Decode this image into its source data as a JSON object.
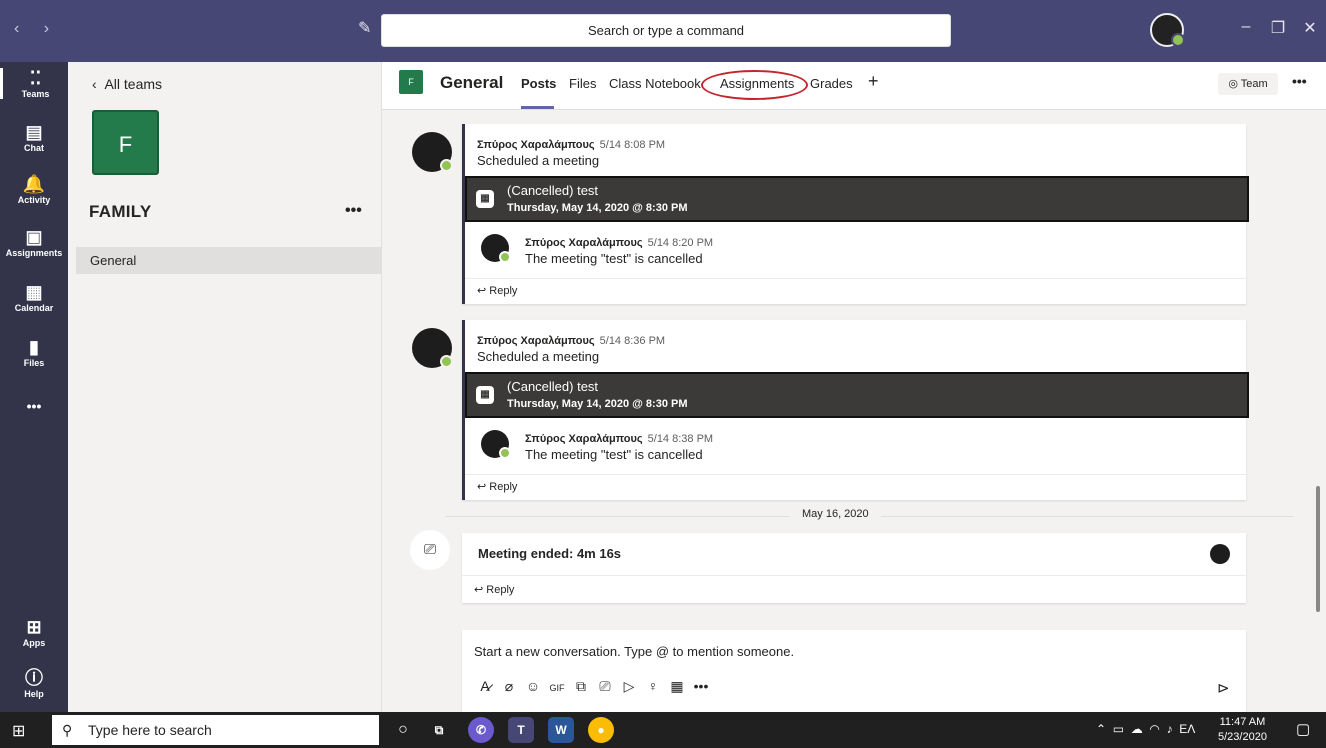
{
  "search": {
    "placeholder": "Search or type a command"
  },
  "rail": {
    "items": [
      {
        "label": "Teams",
        "icon": "teams-icon",
        "glyph": "⁚⁚"
      },
      {
        "label": "Chat",
        "icon": "chat-icon",
        "glyph": "▤"
      },
      {
        "label": "Activity",
        "icon": "bell-icon",
        "glyph": "🔔"
      },
      {
        "label": "Assignments",
        "icon": "assignments-icon",
        "glyph": "▣"
      },
      {
        "label": "Calendar",
        "icon": "calendar-icon",
        "glyph": "▦"
      },
      {
        "label": "Files",
        "icon": "files-icon",
        "glyph": "▮"
      }
    ],
    "more": "•••",
    "apps_label": "Apps",
    "help_label": "Help"
  },
  "team_panel": {
    "back_label": "All teams",
    "team_initial": "F",
    "team_name": "FAMILY",
    "more": "•••",
    "channel": "General"
  },
  "header": {
    "channel_initial": "F",
    "channel_name": "General",
    "tabs": [
      "Posts",
      "Files",
      "Class Notebook",
      "Assignments",
      "Grades"
    ],
    "add": "+",
    "team_button": "◎ Team",
    "more": "•••"
  },
  "posts": [
    {
      "author": "Σπύρος Χαραλάμπους",
      "time": "5/14 8:08 PM",
      "text": "Scheduled a meeting",
      "meeting_title": "(Cancelled) test",
      "meeting_date": "Thursday, May 14, 2020 @ 8:30 PM",
      "reply_author": "Σπύρος Χαραλάμπους",
      "reply_time": "5/14 8:20 PM",
      "reply_text": "The meeting \"test\" is cancelled",
      "reply_label": "↩ Reply"
    },
    {
      "author": "Σπύρος Χαραλάμπους",
      "time": "5/14 8:36 PM",
      "text": "Scheduled a meeting",
      "meeting_title": "(Cancelled) test",
      "meeting_date": "Thursday, May 14, 2020 @ 8:30 PM",
      "reply_author": "Σπύρος Χαραλάμπους",
      "reply_time": "5/14 8:38 PM",
      "reply_text": "The meeting \"test\" is cancelled",
      "reply_label": "↩ Reply"
    }
  ],
  "date_separator": "May 16, 2020",
  "meeting_ended": {
    "text": "Meeting ended: 4m 16s",
    "reply_label": "↩ Reply"
  },
  "compose": {
    "placeholder": "Start a new conversation. Type @ to mention someone.",
    "tools": [
      "A̷",
      "⌀",
      "☺",
      "GIF",
      "⧉",
      "⎚",
      "▷",
      "♀",
      "▦",
      "•••"
    ],
    "send": "⊳"
  },
  "taskbar": {
    "search_placeholder": "Type here to search",
    "tray_lang": "EΛ",
    "time": "11:47 AM",
    "date": "5/23/2020"
  }
}
